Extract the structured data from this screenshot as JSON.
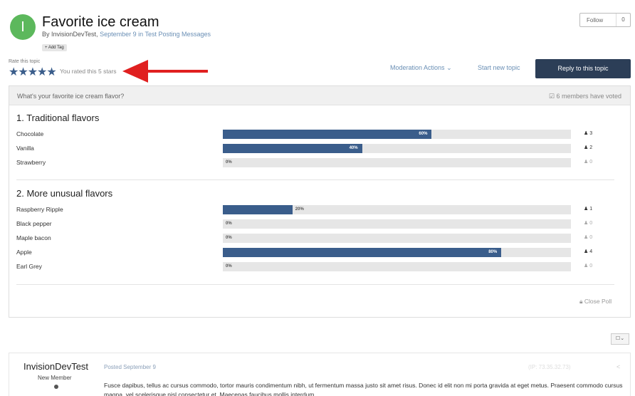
{
  "topic": {
    "avatar_letter": "I",
    "avatar_color": "#5cb85c",
    "title": "Favorite ice cream",
    "by_prefix": "By",
    "author": "InvisionDevTest,",
    "date": "September 9",
    "in_text": "in",
    "forum": "Test Posting Messages",
    "add_tag": "+ Add Tag",
    "follow_label": "Follow",
    "follow_count": "0"
  },
  "rating": {
    "label": "Rate this topic",
    "stars_value": 5,
    "stars_max": 5,
    "rated_text": "You rated this 5 stars"
  },
  "actions": {
    "moderation": "Moderation Actions",
    "start_new_topic": "Start new topic",
    "reply": "Reply to this topic"
  },
  "poll": {
    "question": "What's your favorite ice cream flavor?",
    "voted_text": "6 members have voted",
    "close_poll": "Close Poll",
    "sections": [
      {
        "title": "1. Traditional flavors",
        "choices": [
          {
            "label": "Chocolate",
            "pct": 60,
            "pct_label": "60%",
            "votes": "3"
          },
          {
            "label": "Vanilla",
            "pct": 40,
            "pct_label": "40%",
            "votes": "2"
          },
          {
            "label": "Strawberry",
            "pct": 0,
            "pct_label": "0%",
            "votes": "0"
          }
        ]
      },
      {
        "title": "2. More unusual flavors",
        "choices": [
          {
            "label": "Raspberry Ripple",
            "pct": 20,
            "pct_label": "20%",
            "votes": "1"
          },
          {
            "label": "Black pepper",
            "pct": 0,
            "pct_label": "0%",
            "votes": "0"
          },
          {
            "label": "Maple bacon",
            "pct": 0,
            "pct_label": "0%",
            "votes": "0"
          },
          {
            "label": "Apple",
            "pct": 80,
            "pct_label": "80%",
            "votes": "4"
          },
          {
            "label": "Earl Grey",
            "pct": 0,
            "pct_label": "0%",
            "votes": "0"
          }
        ]
      }
    ]
  },
  "post": {
    "author": "InvisionDevTest",
    "rank": "New Member",
    "posted": "Posted September 9",
    "ip": "(IP: 73.35.32.73)",
    "body": "Fusce dapibus, tellus ac cursus commodo, tortor mauris condimentum nibh, ut fermentum massa justo sit amet risus. Donec id elit non mi porta gravida at eget metus. Praesent commodo cursus magna, vel scelerisque nisl consectetur et. Maecenas faucibus mollis interdum."
  },
  "colors": {
    "accent": "#3a5d8b",
    "reply_button": "#2c3e57",
    "link": "#6a8fb5",
    "arrow": "#e02020"
  }
}
